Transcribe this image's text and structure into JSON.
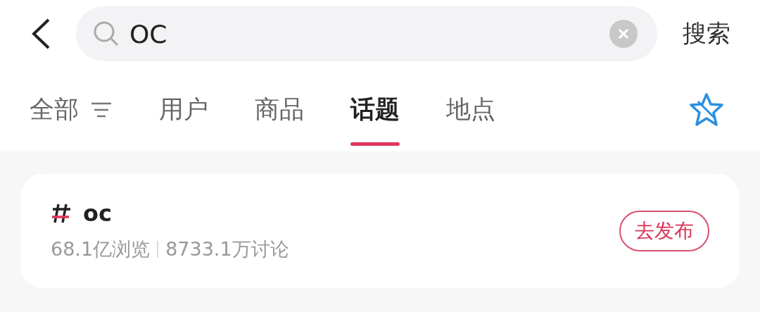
{
  "search": {
    "value": "OC",
    "button": "搜索"
  },
  "tabs": [
    {
      "label": "全部",
      "selected": false,
      "kind": "filter"
    },
    {
      "label": "用户",
      "selected": false,
      "kind": "plain"
    },
    {
      "label": "商品",
      "selected": false,
      "kind": "plain"
    },
    {
      "label": "话题",
      "selected": true,
      "kind": "plain"
    },
    {
      "label": "地点",
      "selected": false,
      "kind": "plain"
    }
  ],
  "topics": [
    {
      "name": "oc",
      "views": "68.1亿浏览",
      "discussions": "8733.1万讨论",
      "action": "去发布"
    }
  ]
}
